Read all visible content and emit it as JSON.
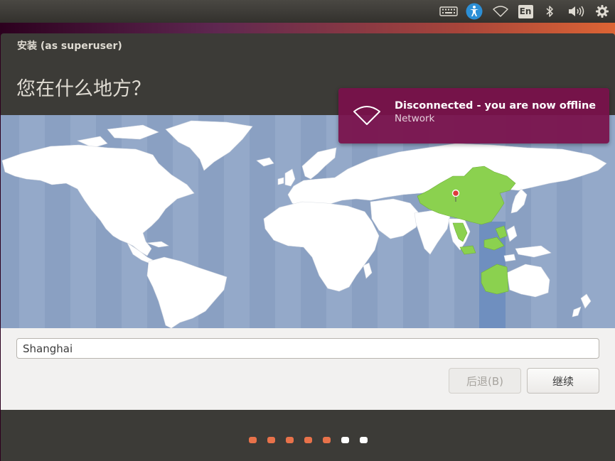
{
  "top_panel": {
    "language_indicator": "En",
    "icons": [
      "keyboard-icon",
      "accessibility-icon",
      "wifi-icon",
      "language-indicator",
      "bluetooth-icon",
      "volume-icon",
      "settings-gear-icon"
    ]
  },
  "window": {
    "title": "安装 (as superuser)",
    "heading": "您在什么地方？"
  },
  "location": {
    "value": "Shanghai",
    "selected_region_color": "#8bd14f",
    "timezone_highlight_color": "#6f8fbf",
    "pin_color": "#dd3b3b"
  },
  "buttons": {
    "back_label": "后退(B)",
    "continue_label": "继续"
  },
  "progress": {
    "total_steps": 7,
    "completed_steps": 5,
    "done_color": "#e8724a",
    "todo_color": "#ffffff"
  },
  "notification": {
    "title": "Disconnected - you are now offline",
    "body": "Network",
    "icon": "wifi-icon",
    "background": "#7a104a"
  }
}
